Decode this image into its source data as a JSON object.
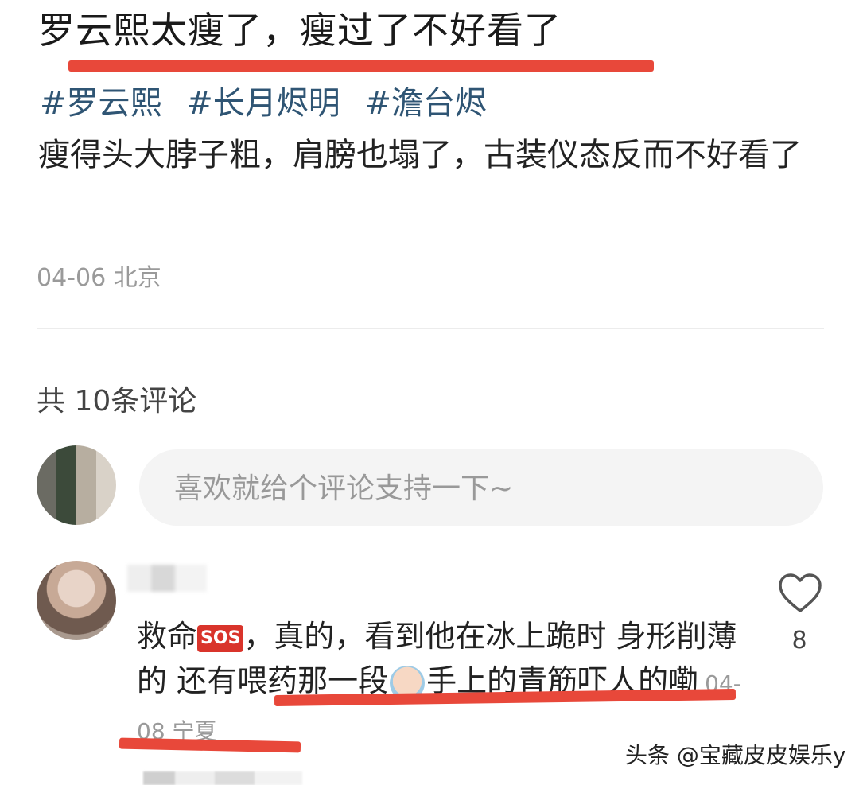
{
  "post": {
    "title": "罗云熙太瘦了，瘦过了不好看了",
    "tags": [
      "#罗云熙",
      "#长月烬明",
      "#澹台烬"
    ],
    "body": "瘦得头大脖子粗，肩膀也塌了，古装仪态反而不好看了",
    "date": "04-06",
    "location": "北京"
  },
  "comments_header": {
    "count_label": "共 10条评论"
  },
  "comment_input": {
    "placeholder": "喜欢就给个评论支持一下~"
  },
  "comment": {
    "text_part1": "救命",
    "sos_badge": "SOS",
    "text_part2": "，真的，看到他在冰上跪时 身形削薄的 还有喂药那一段",
    "text_part3": "手上的青筋吓人的嘞",
    "date": "04-08",
    "location": "宁夏",
    "like_count": "8"
  },
  "watermark": "头条 @宝藏皮皮娱乐y",
  "colors": {
    "accent_underline": "#e8483a",
    "tag_color": "#2f5574"
  }
}
